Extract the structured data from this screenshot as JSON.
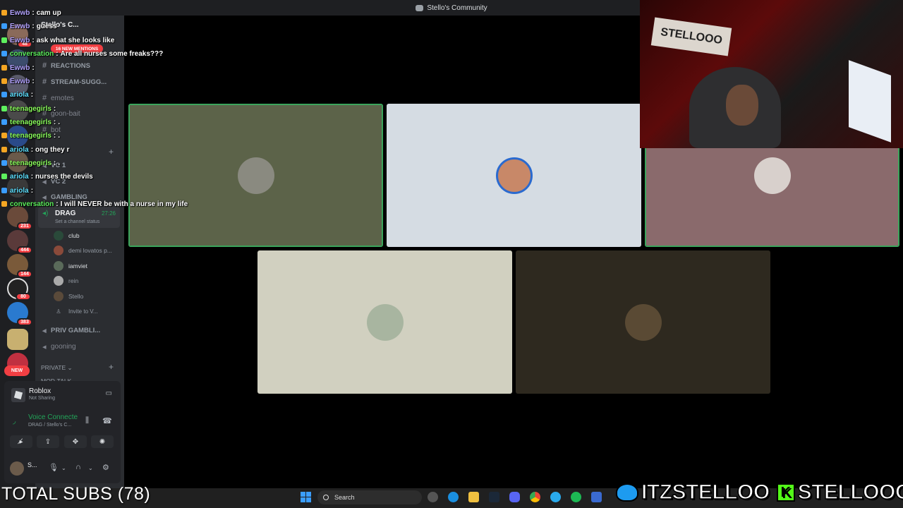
{
  "window": {
    "title": "Stello's Community"
  },
  "server": {
    "name": "Stello's C...",
    "mentions_pill": "16 NEW MENTIONS"
  },
  "channels": {
    "text": [
      "reactions",
      "stream-sugg...",
      "emotes",
      "goon-bait",
      "bot"
    ],
    "voice": [
      "VC 1",
      "VC 2",
      "GAMBLING"
    ],
    "active_voice": {
      "name": "DRAG",
      "time": "27:26",
      "status": "Set a channel status"
    },
    "voice_users": [
      "club",
      "demi lovatos p...",
      "iamviet",
      "rein",
      "Stello"
    ],
    "invite_label": "Invite to V...",
    "more_voice": [
      "PRIV GAMBLI...",
      "gooning"
    ],
    "private_category": "PRIVATE",
    "mod_category": "MOD-TALK"
  },
  "server_badges": [
    "48",
    "231",
    "444",
    "144",
    "80",
    "383"
  ],
  "new_pill": "NEW",
  "activity": {
    "title": "Roblox",
    "subtitle": "Not Sharing"
  },
  "voice_connection": {
    "title": "Voice Connecte",
    "subtitle": "DRAG / Stello's C..."
  },
  "user": {
    "name": "S..."
  },
  "chat": [
    {
      "user": "Ewwb",
      "text": "cam up",
      "color": "#b3a3ff"
    },
    {
      "user": "Ewwb",
      "text": "guess",
      "color": "#b3a3ff"
    },
    {
      "user": "Ewwb",
      "text": "ask what she looks like",
      "color": "#b3a3ff"
    },
    {
      "user": "conversation",
      "text": "Are all nurses some freaks???",
      "color": "#5ef05e"
    },
    {
      "user": "Ewwb",
      "text": "",
      "color": "#b3a3ff"
    },
    {
      "user": "Ewwb",
      "text": "",
      "color": "#b3a3ff"
    },
    {
      "user": "ariola",
      "text": "",
      "color": "#5ee0ff"
    },
    {
      "user": "teenagegirls",
      "text": "",
      "color": "#8cff5e"
    },
    {
      "user": "teenagegirls",
      "text": ".",
      "color": "#8cff5e"
    },
    {
      "user": "teenagegirls",
      "text": ".",
      "color": "#8cff5e"
    },
    {
      "user": "ariola",
      "text": "ong they r",
      "color": "#5ee0ff"
    },
    {
      "user": "teenagegirls",
      "text": ".",
      "color": "#8cff5e"
    },
    {
      "user": "ariola",
      "text": "nurses the devils",
      "color": "#5ee0ff"
    },
    {
      "user": "ariola",
      "text": "",
      "color": "#5ee0ff"
    },
    {
      "user": "conversation",
      "text": "I will NEVER be with a nurse in my life",
      "color": "#5ef05e"
    }
  ],
  "tiles": [
    {
      "bg": "#5c6349",
      "avatar": "#8a8a80",
      "speaking": true
    },
    {
      "bg": "#d5dce3",
      "avatar": "#c88868",
      "speaking": false
    },
    {
      "bg": "#8a6a6c",
      "avatar": "#d8d0cc",
      "speaking": true
    },
    {
      "bg": "#d1d0c0",
      "avatar": "#a8b5a0",
      "speaking": false
    },
    {
      "bg": "#2e291f",
      "avatar": "#5a4a34",
      "speaking": false
    }
  ],
  "webcam": {
    "sign_text": "STELLOOO"
  },
  "overlay": {
    "total_subs": "TOTAL SUBS (78)",
    "twitter": "ITZSTELLOO",
    "kick": "STELLOOO",
    "kick_letter": "K"
  },
  "taskbar": {
    "search_placeholder": "Search"
  },
  "colors": {
    "discord_green": "#23a559",
    "mention_red": "#f23f43",
    "bg": "#2b2d31"
  }
}
